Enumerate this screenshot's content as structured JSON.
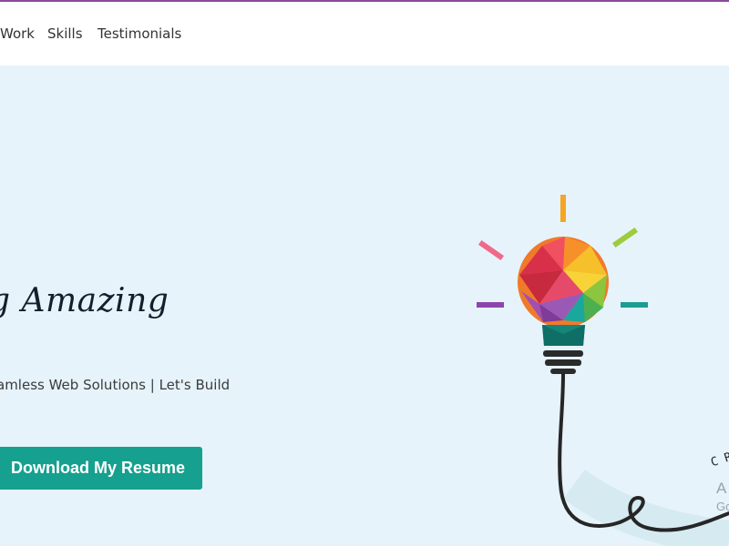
{
  "nav": {
    "items": [
      {
        "label": "Work"
      },
      {
        "label": "Skills"
      },
      {
        "label": "Testimonials"
      }
    ]
  },
  "hero": {
    "headline": "g Amazing",
    "tagline": "amless Web Solutions | Let's Build",
    "resume_button": "Download My Resume"
  },
  "illustration": {
    "name": "lightbulb-icon",
    "curved_text": "C R",
    "side_text_1": "A",
    "side_text_2": "Go"
  },
  "colors": {
    "accent": "#15a08f",
    "top_line": "#8a4a9a",
    "hero_bg": "#e6f3fb"
  }
}
